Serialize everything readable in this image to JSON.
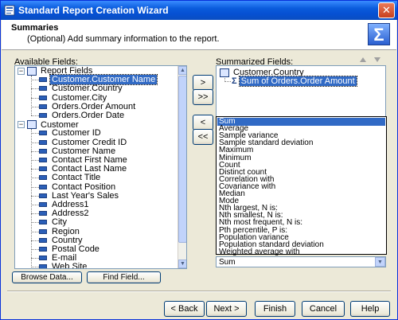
{
  "window": {
    "title": "Standard Report Creation Wizard",
    "close_glyph": "✕"
  },
  "header": {
    "title": "Summaries",
    "subtitle": "(Optional) Add summary information to the report.",
    "icon": "sigma-icon",
    "icon_glyph": "Σ"
  },
  "available": {
    "label": "Available Fields:",
    "groups": [
      {
        "name": "Report Fields",
        "expander": "−",
        "items": [
          "Customer.Customer Name",
          "Customer.Country",
          "Customer.City",
          "Orders.Order Amount",
          "Orders.Order Date"
        ],
        "selected": "Customer.Customer Name"
      },
      {
        "name": "Customer",
        "expander": "−",
        "items": [
          "Customer ID",
          "Customer Credit ID",
          "Customer Name",
          "Contact First Name",
          "Contact Last Name",
          "Contact Title",
          "Contact Position",
          "Last Year's Sales",
          "Address1",
          "Address2",
          "City",
          "Region",
          "Country",
          "Postal Code",
          "E-mail",
          "Web Site"
        ]
      }
    ]
  },
  "transfer": {
    "add": ">",
    "add_all": ">>",
    "remove": "<",
    "remove_all": "<<"
  },
  "summarized": {
    "label": "Summarized Fields:",
    "group": "Customer.Country",
    "item": "Sum of Orders.Order Amount",
    "item_icon_glyph": "Σ"
  },
  "summary_type": {
    "options": [
      "Sum",
      "Average",
      "Sample variance",
      "Sample standard deviation",
      "Maximum",
      "Minimum",
      "Count",
      "Distinct count",
      "Correlation with",
      "Covariance with",
      "Median",
      "Mode",
      "Nth largest, N is:",
      "Nth smallest, N is:",
      "Nth most frequent, N is:",
      "Pth percentile, P is:",
      "Population variance",
      "Population standard deviation",
      "Weighted average with"
    ],
    "selected": "Sum",
    "value": "Sum"
  },
  "buttons": {
    "browse": "Browse Data...",
    "find": "Find Field...",
    "back": "< Back",
    "next": "Next >",
    "finish": "Finish",
    "cancel": "Cancel",
    "help": "Help"
  }
}
